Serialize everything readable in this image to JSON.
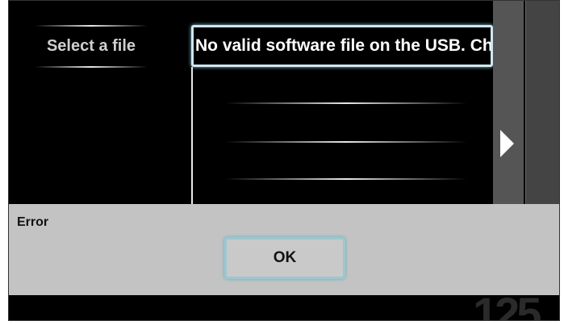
{
  "file_menu": {
    "title": "Select a file",
    "selected_item": "No valid software file on the USB. Chec",
    "nav_arrow_icon": "triangle-right-icon"
  },
  "dialog": {
    "title": "Error",
    "ok_label": "OK"
  },
  "watermark": "125",
  "colors": {
    "background": "#000000",
    "dialog_bg": "#c3c3c3",
    "highlight": "#9cc7cf"
  }
}
